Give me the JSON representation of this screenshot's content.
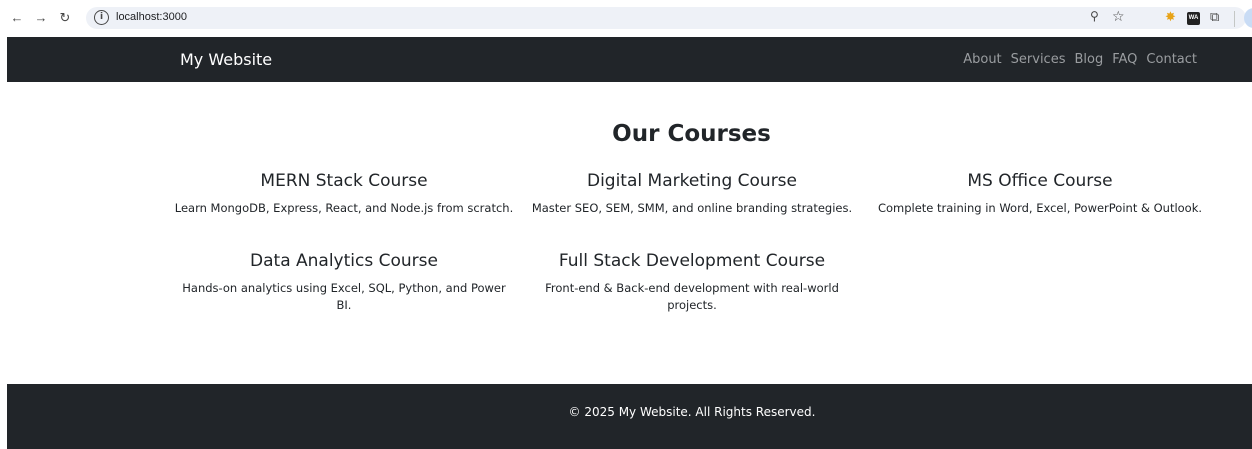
{
  "browser": {
    "url": "localhost:3000",
    "icons": [
      "back-arrow-icon",
      "forward-arrow-icon",
      "reload-icon",
      "info-icon",
      "zoom-icon",
      "star-icon",
      "extension-icon",
      "wa-extension-icon",
      "extensions-puzzle-icon"
    ]
  },
  "navbar": {
    "brand": "My Website",
    "links": [
      "About",
      "Services",
      "Blog",
      "FAQ",
      "Contact"
    ],
    "background": "#212529"
  },
  "main": {
    "title": "Our Courses",
    "courses": [
      {
        "title": "MERN Stack Course",
        "description": "Learn MongoDB, Express, React, and Node.js from scratch."
      },
      {
        "title": "Digital Marketing Course",
        "description": "Master SEO, SEM, SMM, and online branding strategies."
      },
      {
        "title": "MS Office Course",
        "description": "Complete training in Word, Excel, PowerPoint & Outlook."
      },
      {
        "title": "Data Analytics Course",
        "description": "Hands-on analytics using Excel, SQL, Python, and Power BI."
      },
      {
        "title": "Full Stack Development Course",
        "description": "Front-end & Back-end development with real-world projects."
      }
    ]
  },
  "footer": {
    "text": "© 2025 My Website. All Rights Reserved."
  }
}
